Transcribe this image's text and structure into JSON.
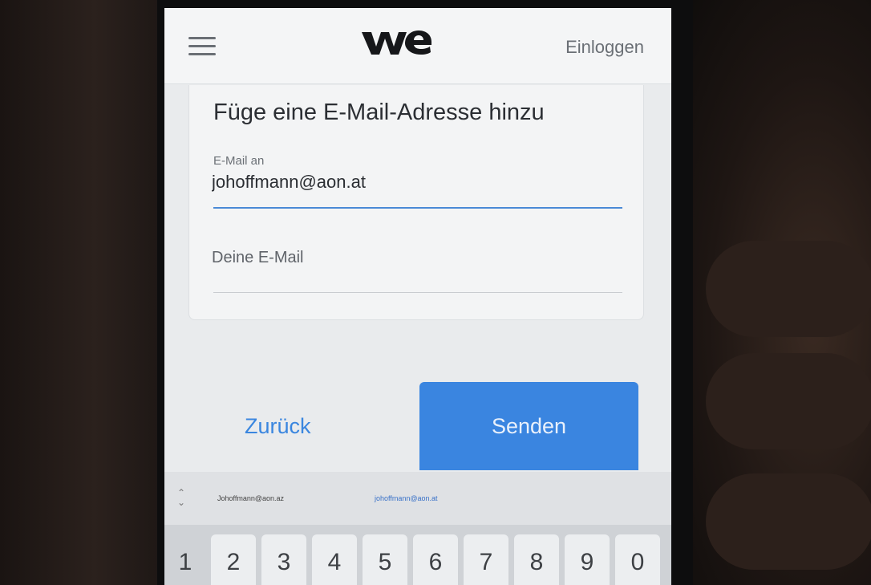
{
  "header": {
    "logo_alt": "we",
    "login_label": "Einloggen"
  },
  "card": {
    "title": "Füge eine E-Mail-Adresse hinzu",
    "to_field": {
      "label": "E-Mail an",
      "value": "johoffmann@aon.at"
    },
    "from_field": {
      "placeholder": "Deine E-Mail"
    }
  },
  "actions": {
    "back_label": "Zurück",
    "send_label": "Senden"
  },
  "autofill": {
    "suggestions": [
      "Johoffmann@aon.az",
      "johoffmann@aon.at"
    ]
  },
  "keyboard": {
    "number_row": [
      "1",
      "2",
      "3",
      "4",
      "5",
      "6",
      "7",
      "8",
      "9",
      "0"
    ]
  },
  "colors": {
    "accent_blue": "#3a85e0",
    "link_blue": "#3a86df",
    "screen_bg": "#e9ebed"
  }
}
